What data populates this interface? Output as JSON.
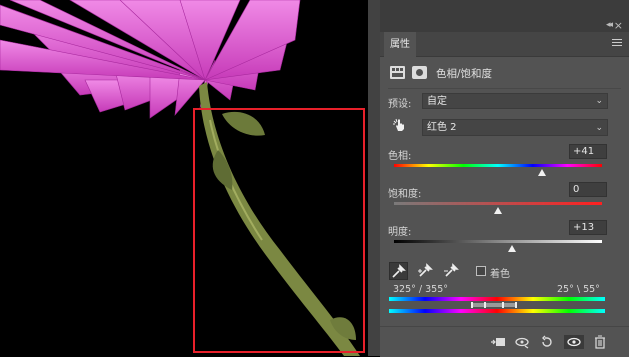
{
  "panel": {
    "tab_label": "属性",
    "header_title": "色相/饱和度"
  },
  "preset": {
    "label": "预设:",
    "value": "自定"
  },
  "channel": {
    "value": "红色 2"
  },
  "hue": {
    "label": "色相:",
    "value": "+41",
    "level": 0.71
  },
  "saturation": {
    "label": "饱和度:",
    "value": "0",
    "level": 0.5
  },
  "lightness": {
    "label": "明度:",
    "value": "+13",
    "level": 0.565
  },
  "colorize": {
    "label": "着色"
  },
  "range": {
    "left": "325° / 355°",
    "right": "25° \\ 55°"
  },
  "icons": {
    "header_adjustment": "hue-saturation-icon",
    "header_mask": "mask-icon",
    "hand": "targeted-adjustment-hand-icon",
    "eyedroppers": [
      "eyedropper-icon",
      "eyedropper-plus-icon",
      "eyedropper-minus-icon"
    ],
    "bottom": [
      "clip-to-layer-icon",
      "view-previous-state-icon",
      "reset-icon",
      "visibility-eye-icon",
      "delete-icon"
    ]
  },
  "colors": {
    "panel_bg": "#535353",
    "canvas_bg": "#000000",
    "selection_box": "#e8202a",
    "flower": "#e25ad4",
    "stem": "#7d8a44"
  }
}
